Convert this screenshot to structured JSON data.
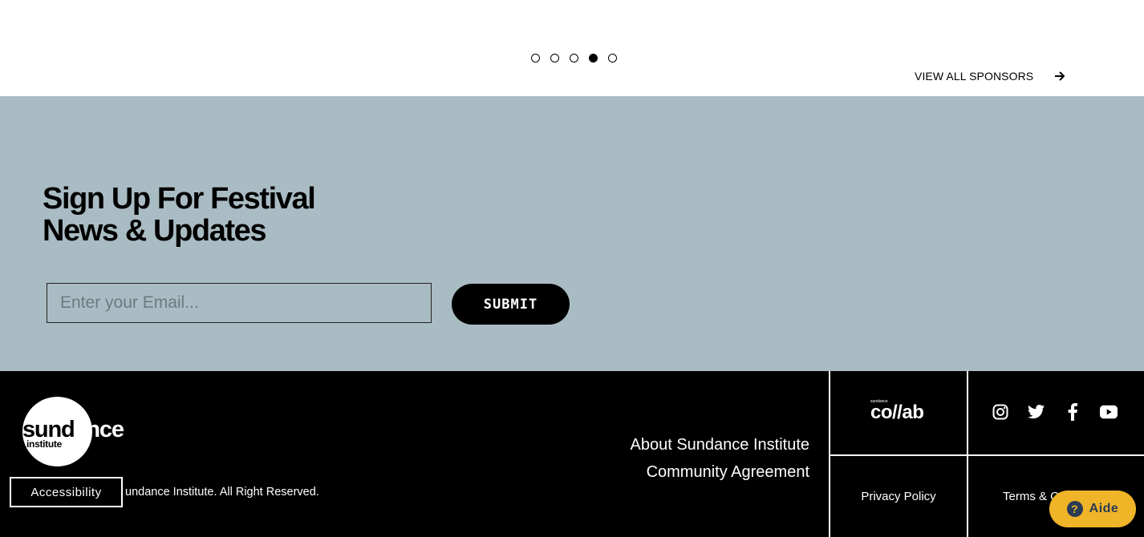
{
  "carousel": {
    "dots": 5,
    "active_index": 3
  },
  "sponsors": {
    "view_all_label": "VIEW ALL SPONSORS"
  },
  "signup": {
    "title_line1": "Sign Up For Festival",
    "title_line2": "News & Updates",
    "email_placeholder": "Enter your Email...",
    "submit_label": "SUBMIT",
    "background_color": "#aabcc3"
  },
  "footer": {
    "logo_word": "sundance",
    "logo_sub": "institute",
    "copyright": "undance Institute. All Right Reserved.",
    "accessibility_label": "Accessibility",
    "links": [
      "About Sundance Institute",
      "Community Agreement"
    ],
    "collab_small": "sundance",
    "collab_word": "co//ab",
    "social_icons": [
      "instagram-icon",
      "twitter-icon",
      "facebook-icon",
      "youtube-icon"
    ],
    "privacy_label": "Privacy Policy",
    "terms_label": "Terms & C"
  },
  "help": {
    "label": "Aide",
    "icon": "?",
    "color": "#f0b429"
  }
}
